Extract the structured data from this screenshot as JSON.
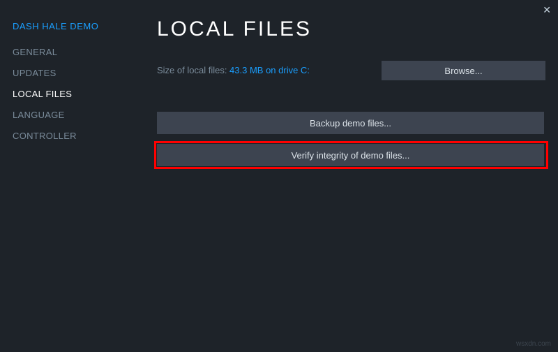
{
  "close_label": "✕",
  "product_name": "DASH HALE DEMO",
  "sidebar": {
    "items": [
      {
        "label": "GENERAL"
      },
      {
        "label": "UPDATES"
      },
      {
        "label": "LOCAL FILES"
      },
      {
        "label": "LANGUAGE"
      },
      {
        "label": "CONTROLLER"
      }
    ]
  },
  "main": {
    "title": "LOCAL FILES",
    "size_label": "Size of local files: ",
    "size_value": "43.3 MB on drive C:",
    "browse_label": "Browse...",
    "backup_label": "Backup demo files...",
    "verify_label": "Verify integrity of demo files..."
  },
  "watermark": "wsxdn.com"
}
